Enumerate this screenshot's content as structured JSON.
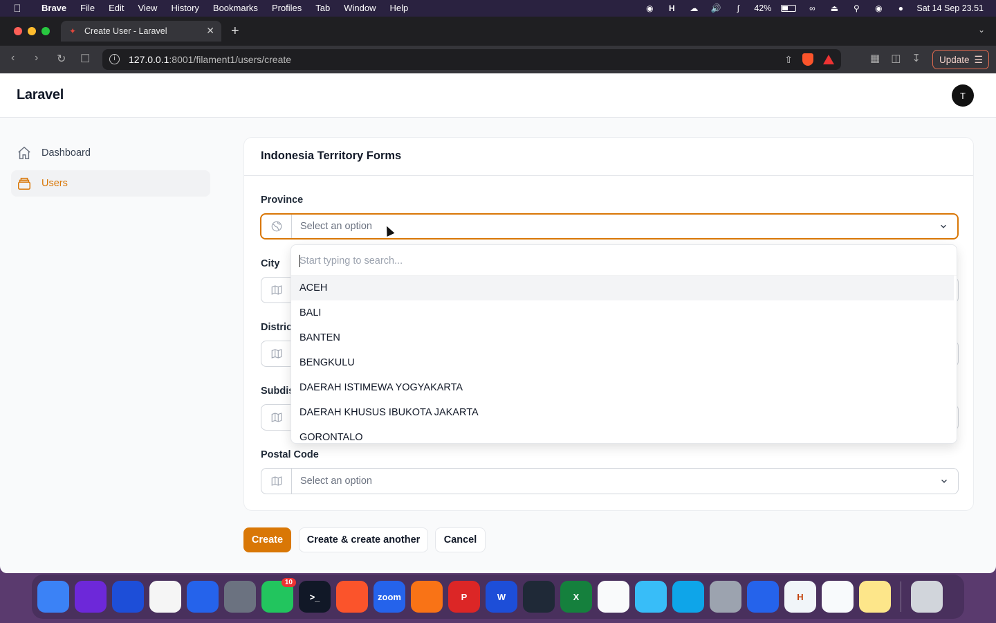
{
  "menubar": {
    "app_name": "Brave",
    "items": [
      "File",
      "Edit",
      "View",
      "History",
      "Bookmarks",
      "Profiles",
      "Tab",
      "Window",
      "Help"
    ],
    "battery": "42%",
    "datetime": "Sat 14 Sep  23.51"
  },
  "browser": {
    "tab_title": "Create User - Laravel",
    "url_host": "127.0.0.1",
    "url_path": ":8001/filament1/users/create",
    "update_label": "Update"
  },
  "page": {
    "brand": "Laravel",
    "avatar_initial": "T",
    "sidebar": {
      "items": [
        {
          "label": "Dashboard",
          "icon": "home-icon",
          "active": false
        },
        {
          "label": "Users",
          "icon": "collection-icon",
          "active": true
        }
      ]
    },
    "form": {
      "title": "Indonesia Territory Forms",
      "fields": [
        {
          "label": "Province",
          "placeholder": "Select an option",
          "icon": "globe-icon"
        },
        {
          "label": "City",
          "placeholder": "",
          "icon": "map-icon"
        },
        {
          "label": "District",
          "placeholder": "",
          "icon": "map-icon"
        },
        {
          "label": "Subdis",
          "placeholder": "",
          "icon": "map-icon"
        },
        {
          "label": "Postal Code",
          "placeholder": "Select an option",
          "icon": "map-icon"
        }
      ],
      "dropdown": {
        "search_placeholder": "Start typing to search...",
        "options": [
          "ACEH",
          "BALI",
          "BANTEN",
          "BENGKULU",
          "DAERAH ISTIMEWA YOGYAKARTA",
          "DAERAH KHUSUS IBUKOTA JAKARTA",
          "GORONTALO"
        ]
      }
    },
    "actions": {
      "create": "Create",
      "create_another": "Create & create another",
      "cancel": "Cancel"
    },
    "accent_color": "#d97706"
  },
  "dock": {
    "apps": [
      {
        "name": "finder-icon",
        "color": "#3b82f6",
        "label": ""
      },
      {
        "name": "siri-icon",
        "color": "#6d28d9",
        "label": ""
      },
      {
        "name": "firefox-icon",
        "color": "#1d4ed8",
        "label": ""
      },
      {
        "name": "photos-icon",
        "color": "#f5f5f5",
        "label": ""
      },
      {
        "name": "app-store-icon",
        "color": "#2563eb",
        "label": ""
      },
      {
        "name": "system-settings-icon",
        "color": "#6b7280",
        "label": ""
      },
      {
        "name": "whatsapp-icon",
        "color": "#22c55e",
        "label": "",
        "badge": "10"
      },
      {
        "name": "terminal-icon",
        "color": "#111827",
        "label": ">_"
      },
      {
        "name": "brave-icon",
        "color": "#fb542b",
        "label": ""
      },
      {
        "name": "zoom-icon",
        "color": "#2563eb",
        "label": "zoom"
      },
      {
        "name": "pen-icon",
        "color": "#f97316",
        "label": ""
      },
      {
        "name": "powerpoint-icon",
        "color": "#dc2626",
        "label": "P"
      },
      {
        "name": "word-icon",
        "color": "#1d4ed8",
        "label": "W"
      },
      {
        "name": "activity-monitor-icon",
        "color": "#1f2937",
        "label": ""
      },
      {
        "name": "excel-icon",
        "color": "#15803d",
        "label": "X"
      },
      {
        "name": "equals-icon",
        "color": "#f9fafb",
        "label": ""
      },
      {
        "name": "migration-icon",
        "color": "#38bdf8",
        "label": ""
      },
      {
        "name": "docker-icon",
        "color": "#0ea5e9",
        "label": ""
      },
      {
        "name": "quicktime-icon",
        "color": "#9ca3af",
        "label": ""
      },
      {
        "name": "vscode-icon",
        "color": "#2563eb",
        "label": ""
      },
      {
        "name": "h-app-icon",
        "color": "#f1f5f9",
        "label": "H"
      },
      {
        "name": "sequel-icon",
        "color": "#f8fafc",
        "label": ""
      },
      {
        "name": "yellow-app-icon",
        "color": "#fde68a",
        "label": ""
      },
      {
        "name": "trash-icon",
        "color": "#d1d5db",
        "label": ""
      }
    ]
  }
}
